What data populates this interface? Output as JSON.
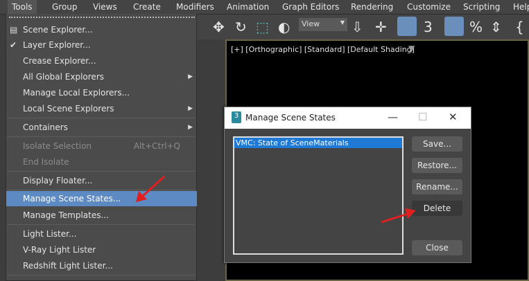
{
  "menubar": {
    "items": [
      "Tools",
      "Group",
      "Views",
      "Create",
      "Modifiers",
      "Animation",
      "Graph Editors",
      "Rendering",
      "Customize",
      "Scripting",
      "Help"
    ]
  },
  "toolbar": {
    "view_select": "View"
  },
  "viewport": {
    "label": "[+] [Orthographic] [Standard] [Default Shading]"
  },
  "tools_menu": {
    "items": [
      {
        "label": "Scene Explorer..."
      },
      {
        "label": "Layer Explorer..."
      },
      {
        "label": "Crease Explorer..."
      },
      {
        "label": "All Global Explorers"
      },
      {
        "label": "Manage Local Explorers..."
      },
      {
        "label": "Local Scene Explorers"
      },
      {
        "label": "Containers"
      },
      {
        "label": "Isolate Selection",
        "shortcut": "Alt+Ctrl+Q"
      },
      {
        "label": "End Isolate"
      },
      {
        "label": "Display Floater..."
      },
      {
        "label": "Manage Scene States..."
      },
      {
        "label": "Manage Templates..."
      },
      {
        "label": "Light Lister..."
      },
      {
        "label": "V-Ray Light Lister"
      },
      {
        "label": "Redshift Light Lister..."
      }
    ]
  },
  "dialog": {
    "title": "Manage Scene States",
    "states": [
      "VMC: State of SceneMaterials"
    ],
    "buttons": {
      "save": "Save...",
      "restore": "Restore...",
      "rename": "Rename...",
      "delete": "Delete",
      "close": "Close"
    }
  },
  "colors": {
    "highlight": "#5d8ac3",
    "selection": "#1f7ad6",
    "arrow": "#e02020"
  }
}
